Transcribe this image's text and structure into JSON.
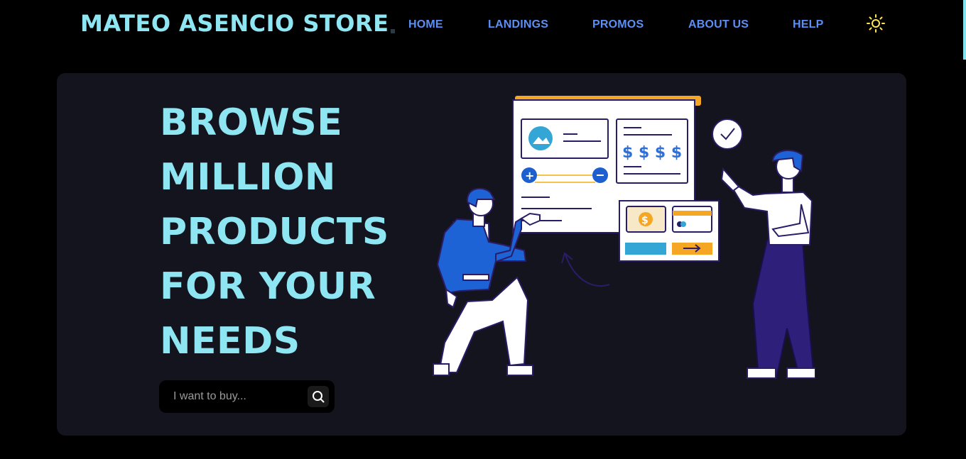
{
  "header": {
    "brand": "MATEO ASENCIO STORE",
    "nav": [
      {
        "label": "HOME"
      },
      {
        "label": "LANDINGS"
      },
      {
        "label": "PROMOS"
      },
      {
        "label": "ABOUT US"
      },
      {
        "label": "HELP"
      }
    ],
    "theme_icon": "sun-icon"
  },
  "hero": {
    "headline": [
      "BROWSE",
      "MILLION",
      "PRODUCTS",
      "FOR YOUR",
      "NEEDS"
    ],
    "search": {
      "placeholder": "I want to buy...",
      "value": "",
      "icon": "search-icon"
    },
    "illustration": {
      "price_symbols": "$ $ $ $",
      "coin_symbol": "$"
    }
  },
  "colors": {
    "background": "#000000",
    "card": "#14141e",
    "accent_cyan": "#8ee6f2",
    "nav_blue": "#5b8ff5",
    "sun_yellow": "#ffe94a"
  }
}
